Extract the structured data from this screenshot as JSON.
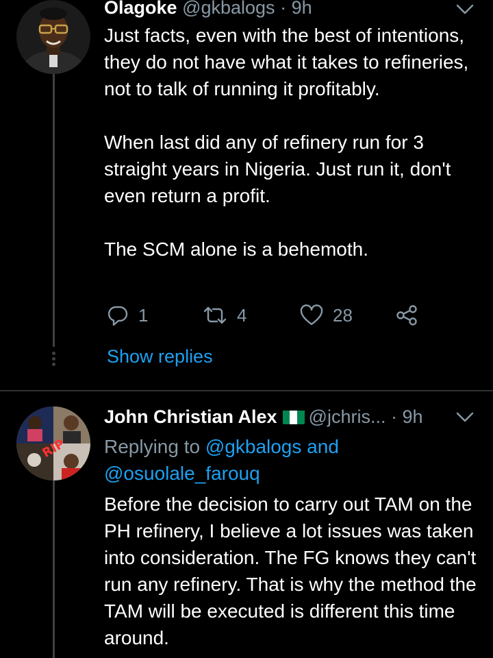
{
  "tweet1": {
    "display_name": "Olagoke",
    "handle": "@gkbalogs",
    "separator": "·",
    "time": "9h",
    "text": "Just facts, even with the best of intentions, they do not have what it takes to refineries, not to talk of running it profitably.\n\nWhen last did any of refinery run for 3 straight years in Nigeria. Just run it, don't even return a profit.\n\nThe SCM alone is a behemoth.",
    "actions": {
      "reply_count": "1",
      "retweet_count": "4",
      "like_count": "28"
    },
    "show_replies": "Show replies"
  },
  "tweet2": {
    "display_name": "John Christian Alex",
    "flag": "nigeria-flag",
    "handle": "@jchris...",
    "separator": "·",
    "time": "9h",
    "replying_to_prefix": "Replying to",
    "reply_mention_1": "@gkbalogs",
    "reply_and": "and",
    "reply_mention_2": "@osuolale_farouq",
    "text": "Before the decision to carry out TAM on the PH refinery, I believe a lot issues was taken into consideration. The FG knows they can't run any refinery. That is why the method the TAM will be executed is different this time around."
  },
  "colors": {
    "background": "#000000",
    "text": "#ffffff",
    "muted": "#8899a6",
    "link": "#1da1f2",
    "thread_line": "#3d4144",
    "flag_green": "#008751"
  },
  "icons": [
    "chevron-down-icon",
    "reply-icon",
    "retweet-icon",
    "like-icon",
    "share-icon"
  ]
}
